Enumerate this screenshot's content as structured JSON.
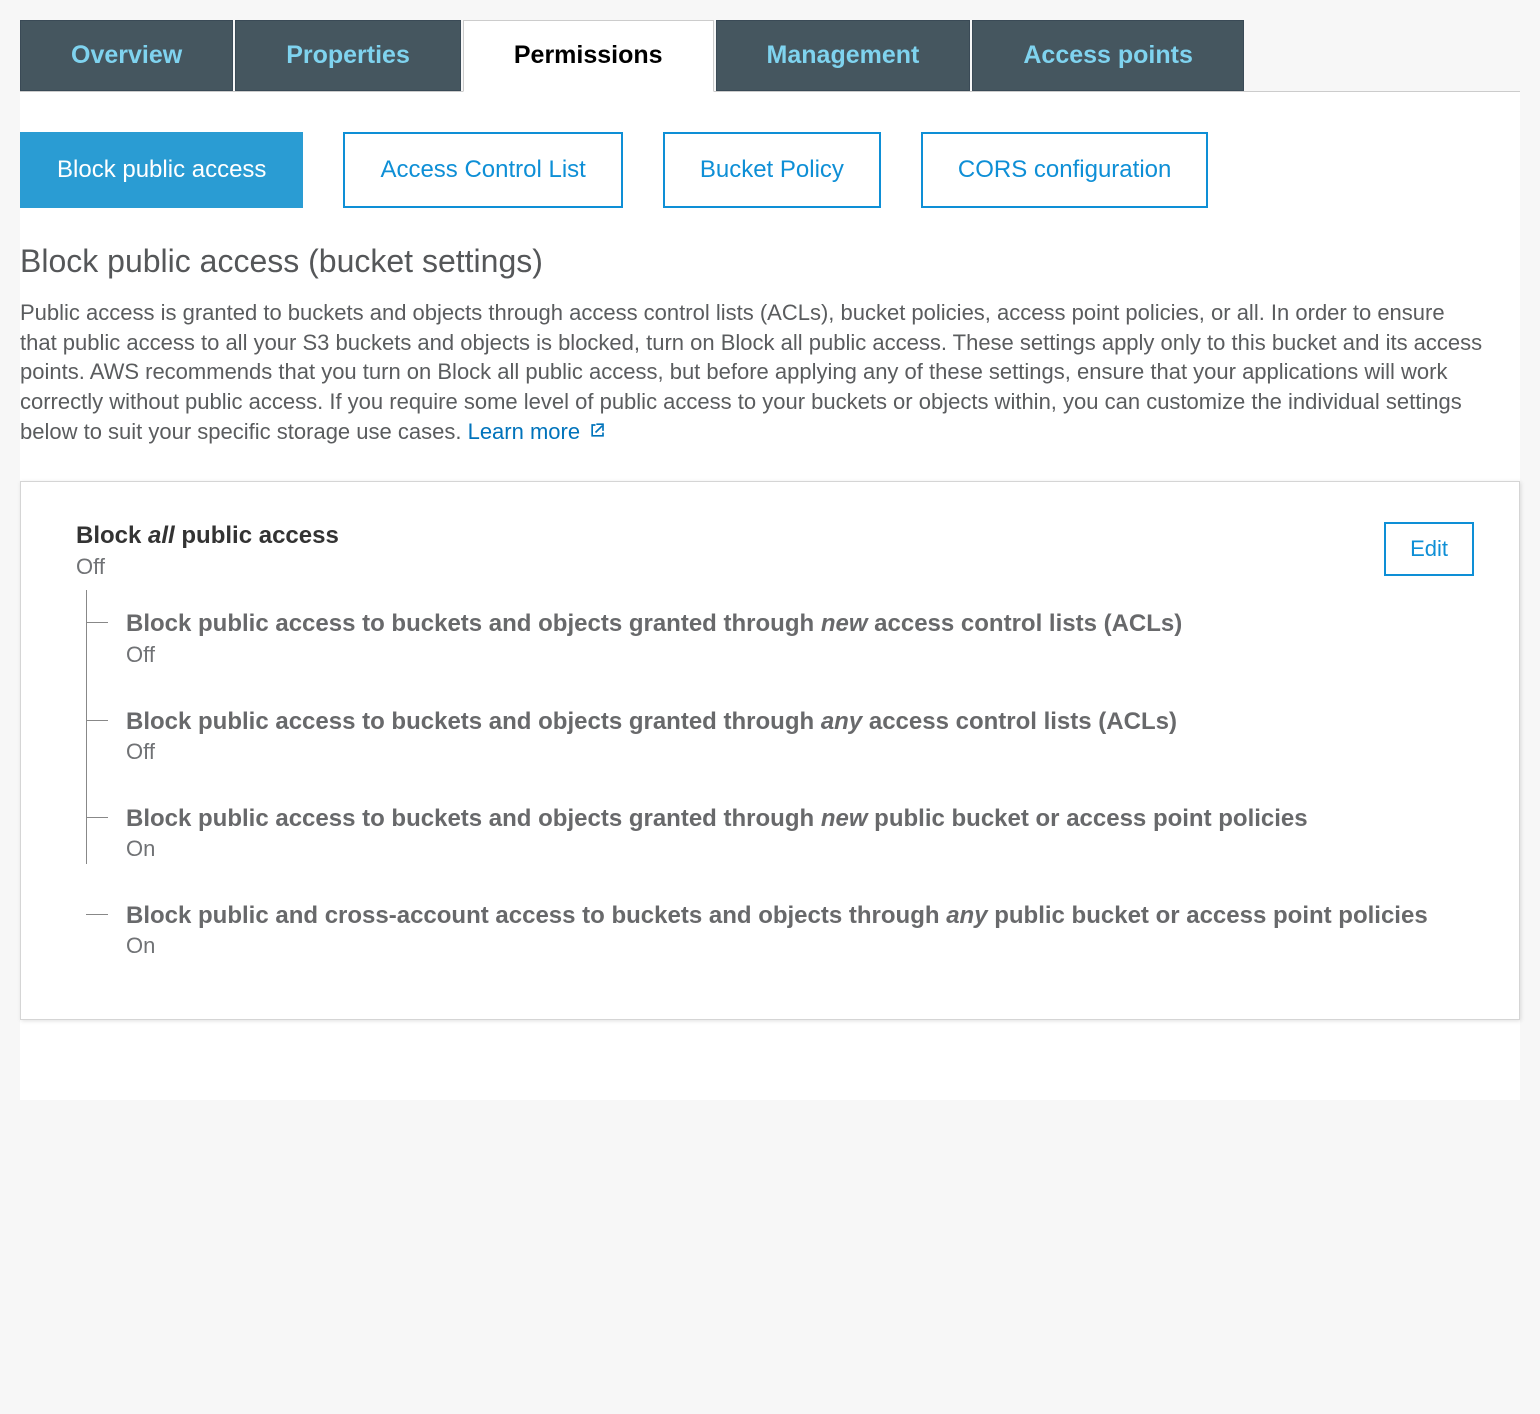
{
  "top_tabs": [
    {
      "label": "Overview",
      "active": false
    },
    {
      "label": "Properties",
      "active": false
    },
    {
      "label": "Permissions",
      "active": true
    },
    {
      "label": "Management",
      "active": false
    },
    {
      "label": "Access points",
      "active": false
    }
  ],
  "sub_tabs": [
    {
      "label": "Block public access",
      "active": true
    },
    {
      "label": "Access Control List",
      "active": false
    },
    {
      "label": "Bucket Policy",
      "active": false
    },
    {
      "label": "CORS configuration",
      "active": false
    }
  ],
  "section": {
    "title": "Block public access (bucket settings)",
    "description": "Public access is granted to buckets and objects through access control lists (ACLs), bucket policies, access point policies, or all. In order to ensure that public access to all your S3 buckets and objects is blocked, turn on Block all public access. These settings apply only to this bucket and its access points. AWS recommends that you turn on Block all public access, but before applying any of these settings, ensure that your applications will work correctly without public access. If you require some level of public access to your buckets or objects within, you can customize the individual settings below to suit your specific storage use cases.",
    "learn_more": "Learn more"
  },
  "panel": {
    "block_all_prefix": "Block ",
    "block_all_italic": "all",
    "block_all_suffix": " public access",
    "block_all_status": "Off",
    "edit_label": "Edit",
    "settings": [
      {
        "prefix": "Block public access to buckets and objects granted through ",
        "italic": "new",
        "suffix": " access control lists (ACLs)",
        "status": "Off"
      },
      {
        "prefix": "Block public access to buckets and objects granted through ",
        "italic": "any",
        "suffix": " access control lists (ACLs)",
        "status": "Off"
      },
      {
        "prefix": "Block public access to buckets and objects granted through ",
        "italic": "new",
        "suffix": " public bucket or access point policies",
        "status": "On"
      },
      {
        "prefix": "Block public and cross-account access to buckets and objects through ",
        "italic": "any",
        "suffix": " public bucket or access point policies",
        "status": "On"
      }
    ]
  }
}
